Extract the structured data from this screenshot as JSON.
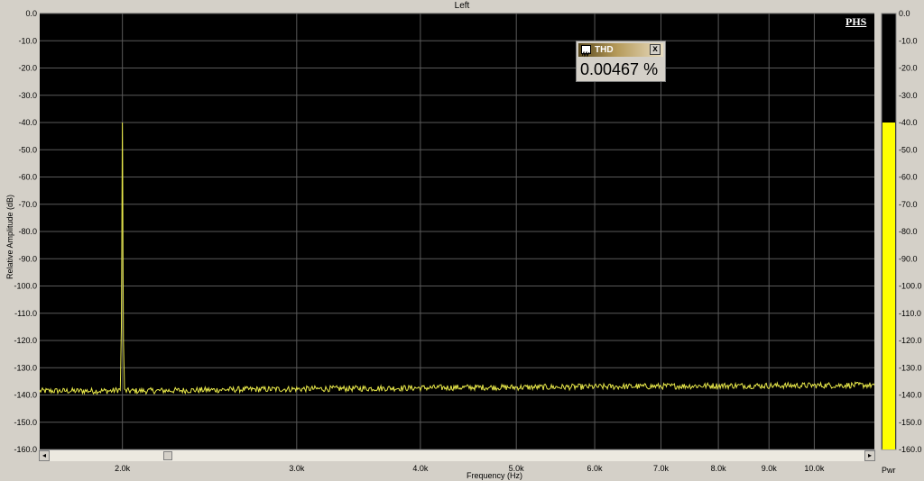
{
  "window": {
    "title": "Left"
  },
  "overlay": {
    "brand": "PHS",
    "thd": {
      "title": "THD",
      "value": "0.00467 %",
      "close": "x",
      "icon": "waveform-icon"
    },
    "pwr_label": "Pwr"
  },
  "colors": {
    "background": "#000000",
    "trace": "#e8e84a",
    "grid": "#5a5a5a",
    "meter_fill": "#ffff00",
    "frame": "#d4d0c8"
  },
  "chart_data": {
    "type": "line",
    "title": "Left",
    "xlabel": "Frequency (Hz)",
    "ylabel": "Relative Amplitude (dB)",
    "x_scale": "log",
    "xlim": [
      1650,
      11500
    ],
    "ylim": [
      -160,
      0
    ],
    "grid": true,
    "x_ticks": [
      {
        "label": "2.0k",
        "value": 2000
      },
      {
        "label": "3.0k",
        "value": 3000
      },
      {
        "label": "4.0k",
        "value": 4000
      },
      {
        "label": "5.0k",
        "value": 5000
      },
      {
        "label": "6.0k",
        "value": 6000
      },
      {
        "label": "7.0k",
        "value": 7000
      },
      {
        "label": "8.0k",
        "value": 8000
      },
      {
        "label": "9.0k",
        "value": 9000
      },
      {
        "label": "10.0k",
        "value": 10000
      }
    ],
    "y_ticks": [
      0,
      -10,
      -20,
      -30,
      -40,
      -50,
      -60,
      -70,
      -80,
      -90,
      -100,
      -110,
      -120,
      -130,
      -140,
      -150,
      -160
    ],
    "y_tick_labels": [
      "0.0",
      "-10.0",
      "-20.0",
      "-30.0",
      "-40.0",
      "-50.0",
      "-60.0",
      "-70.0",
      "-80.0",
      "-90.0",
      "-100.0",
      "-110.0",
      "-120.0",
      "-130.0",
      "-140.0",
      "-150.0",
      "-160.0"
    ],
    "series": [
      {
        "color": "#e8e84a",
        "points": [
          [
            1650,
            -138.5
          ],
          [
            1750,
            -138.5
          ],
          [
            1850,
            -138.5
          ],
          [
            1950,
            -138.5
          ],
          [
            1990,
            -138
          ],
          [
            1995,
            -115
          ],
          [
            1997,
            -90
          ],
          [
            1999,
            -55
          ],
          [
            2000,
            -40
          ],
          [
            2001,
            -55
          ],
          [
            2003,
            -95
          ],
          [
            2005,
            -120
          ],
          [
            2010,
            -138.5
          ],
          [
            2100,
            -138.5
          ],
          [
            2300,
            -138.3
          ],
          [
            2600,
            -138.0
          ],
          [
            3000,
            -137.8
          ],
          [
            3500,
            -137.6
          ],
          [
            4000,
            -137.4
          ],
          [
            4500,
            -137.2
          ],
          [
            5000,
            -137.2
          ],
          [
            6000,
            -137.0
          ],
          [
            7000,
            -136.8
          ],
          [
            8000,
            -136.6
          ],
          [
            9000,
            -136.6
          ],
          [
            10000,
            -136.5
          ],
          [
            11000,
            -136.4
          ],
          [
            11500,
            -136.4
          ]
        ]
      }
    ],
    "meter": {
      "label": "Pwr",
      "level_db": -40,
      "ticks": [
        0,
        -10,
        -20,
        -30,
        -40,
        -50,
        -60,
        -70,
        -80,
        -90,
        -100,
        -110,
        -120,
        -130,
        -140,
        -150,
        -160
      ],
      "tick_labels": [
        "0.0",
        "-10.0",
        "-20.0",
        "-30.0",
        "-40.0",
        "-50.0",
        "-60.0",
        "-70.0",
        "-80.0",
        "-90.0",
        "-100.0",
        "-110.0",
        "-120.0",
        "-130.0",
        "-140.0",
        "-150.0",
        "-160.0"
      ]
    }
  }
}
